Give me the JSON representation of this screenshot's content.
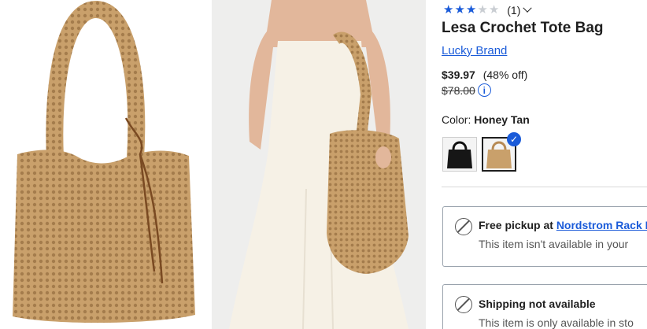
{
  "product": {
    "rating": {
      "filled": 3,
      "total": 5,
      "count_label": "(1)"
    },
    "title": "Lesa Crochet Tote Bag",
    "brand": "Lucky Brand",
    "price": "$39.97",
    "discount": "(48% off)",
    "original_price": "$78.00"
  },
  "color": {
    "label": "Color: ",
    "selected": "Honey Tan",
    "swatches": [
      "black",
      "honey-tan"
    ]
  },
  "fulfillment": {
    "pickup": {
      "title_prefix": "Free pickup at ",
      "store_link": "Nordstrom Rack N",
      "subtitle": "This item isn't available in your"
    },
    "shipping": {
      "title": "Shipping not available",
      "subtitle": "This item is only available in sto"
    }
  },
  "icons": {
    "info": "info-icon",
    "check": "checkmark-icon",
    "unavailable": "prohibited-icon",
    "expand": "chevron-down-icon"
  },
  "colors": {
    "link_blue": "#1a5bd9",
    "tan": "#c9a06b",
    "star_off": "#c9cdd2"
  }
}
